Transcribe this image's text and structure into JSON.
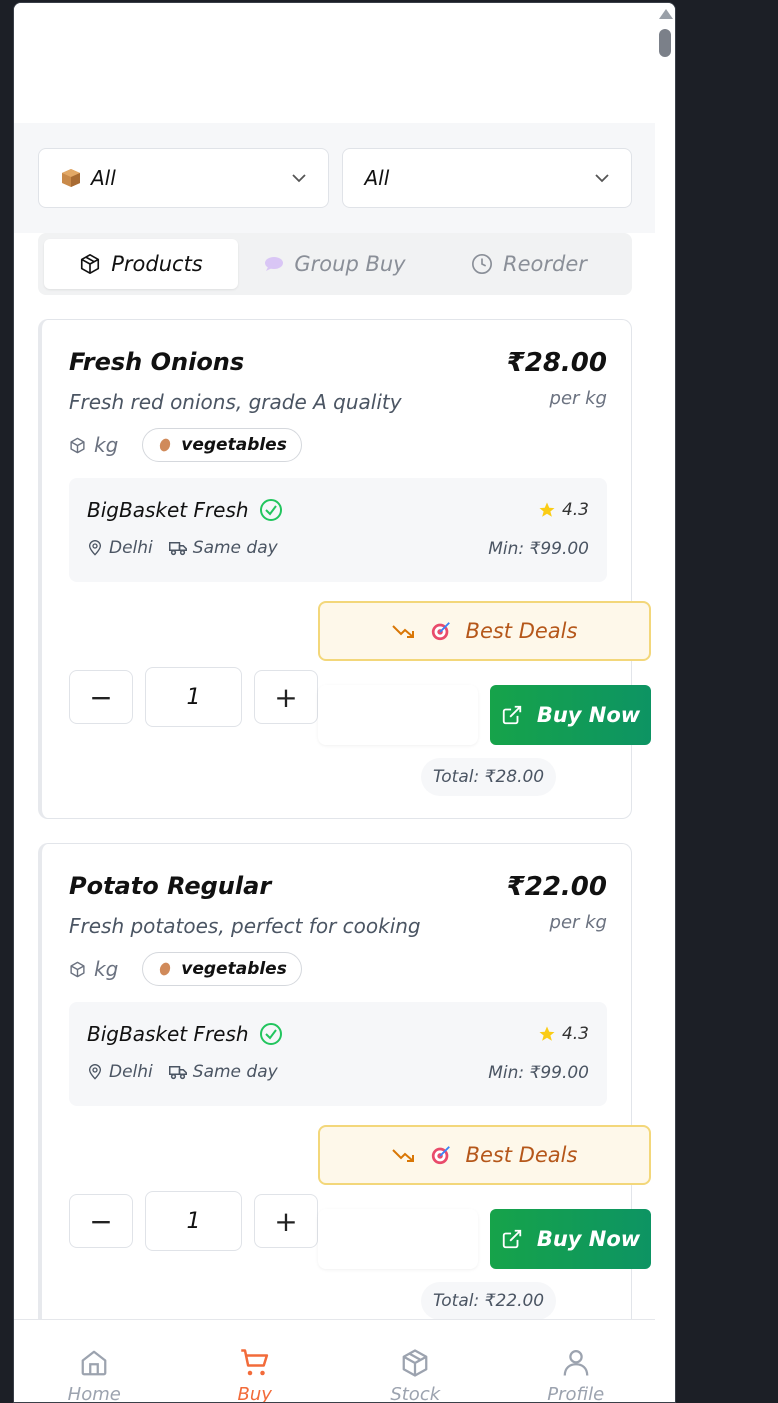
{
  "filters": {
    "category": {
      "value": "All",
      "icon": "package-box-icon"
    },
    "secondary": {
      "value": "All"
    }
  },
  "tabs": [
    {
      "label": "Products",
      "icon": "cube-icon",
      "active": true
    },
    {
      "label": "Group Buy",
      "icon": "speech-bubble-icon",
      "active": false
    },
    {
      "label": "Reorder",
      "icon": "clock-icon",
      "active": false
    }
  ],
  "products": [
    {
      "title": "Fresh Onions",
      "price": "₹28.00",
      "unit_label": "per kg",
      "description": "Fresh red onions, grade A quality",
      "unit": "kg",
      "category": "vegetables",
      "seller": {
        "name": "BigBasket Fresh",
        "rating": "4.3",
        "location": "Delhi",
        "delivery": "Same day",
        "min_order": "Min: ₹99.00"
      },
      "deals_label": "Best Deals",
      "quantity": "1",
      "buy_label": "Buy Now",
      "total": "Total: ₹28.00"
    },
    {
      "title": "Potato Regular",
      "price": "₹22.00",
      "unit_label": "per kg",
      "description": "Fresh potatoes, perfect for cooking",
      "unit": "kg",
      "category": "vegetables",
      "seller": {
        "name": "BigBasket Fresh",
        "rating": "4.3",
        "location": "Delhi",
        "delivery": "Same day",
        "min_order": "Min: ₹99.00"
      },
      "deals_label": "Best Deals",
      "quantity": "1",
      "buy_label": "Buy Now",
      "total": "Total: ₹22.00"
    }
  ],
  "nav": [
    {
      "label": "Home",
      "icon": "home-icon",
      "active": false
    },
    {
      "label": "Buy",
      "icon": "cart-icon",
      "active": true
    },
    {
      "label": "Stock",
      "icon": "cube-icon",
      "active": false
    },
    {
      "label": "Profile",
      "icon": "user-icon",
      "active": false
    }
  ],
  "colors": {
    "accent": "#f26b3a",
    "buy": "#16a34a",
    "deals_bg": "#fef8ea",
    "deals_text": "#b5571a"
  }
}
